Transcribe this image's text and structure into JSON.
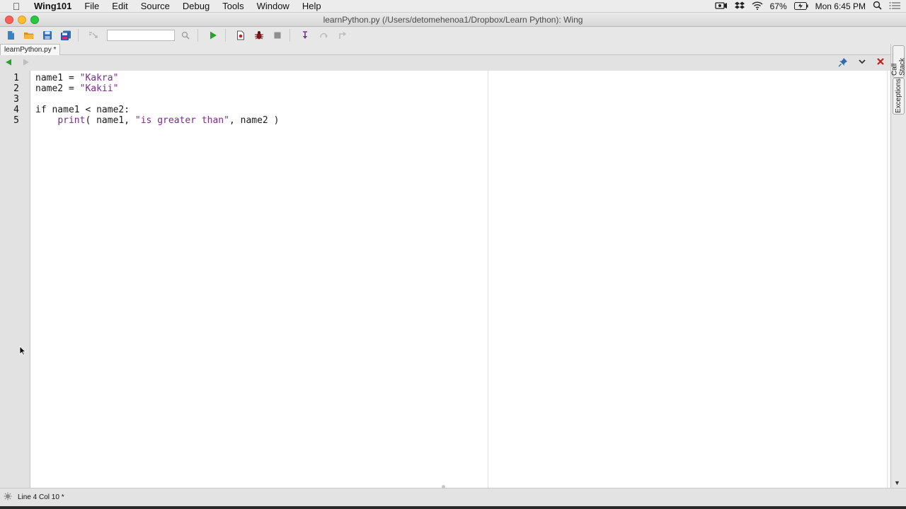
{
  "menubar": {
    "app_name": "Wing101",
    "items": [
      "File",
      "Edit",
      "Source",
      "Debug",
      "Tools",
      "Window",
      "Help"
    ],
    "battery": "67%",
    "clock": "Mon 6:45 PM"
  },
  "window": {
    "title": "learnPython.py (/Users/detomehenoa1/Dropbox/Learn Python): Wing"
  },
  "toolbar": {
    "search_value": "",
    "icons": [
      "new-file-icon",
      "open-file-icon",
      "save-icon",
      "save-all-icon",
      "goto-def-icon",
      "search-icon",
      "run-icon",
      "debug-file-icon",
      "debug-icon",
      "stop-icon",
      "step-into-icon",
      "step-over-icon",
      "step-out-icon"
    ]
  },
  "tabs": [
    {
      "label": "learnPython.py *"
    }
  ],
  "side_tools": {
    "call_stack": "Call Stack",
    "exceptions": "Exceptions"
  },
  "editor": {
    "line_numbers": [
      "1",
      "2",
      "3",
      "4",
      "5"
    ],
    "lines": [
      {
        "parts": [
          {
            "t": "name1 = ",
            "c": "plain"
          },
          {
            "t": "\"Kakra\"",
            "c": "str"
          }
        ]
      },
      {
        "parts": [
          {
            "t": "name2 = ",
            "c": "plain"
          },
          {
            "t": "\"Kakii\"",
            "c": "str"
          }
        ]
      },
      {
        "parts": []
      },
      {
        "parts": [
          {
            "t": "if name1 < name2:",
            "c": "plain"
          }
        ]
      },
      {
        "parts": [
          {
            "t": "    ",
            "c": "plain"
          },
          {
            "t": "print",
            "c": "builtin"
          },
          {
            "t": "( name1, ",
            "c": "plain"
          },
          {
            "t": "\"is greater than\"",
            "c": "str"
          },
          {
            "t": ", name2 )",
            "c": "plain"
          }
        ]
      }
    ]
  },
  "status": {
    "position": "Line 4 Col 10 *"
  },
  "colors": {
    "string": "#7a2a8a",
    "run_green": "#2aa32a",
    "close_red": "#c41f1f"
  }
}
